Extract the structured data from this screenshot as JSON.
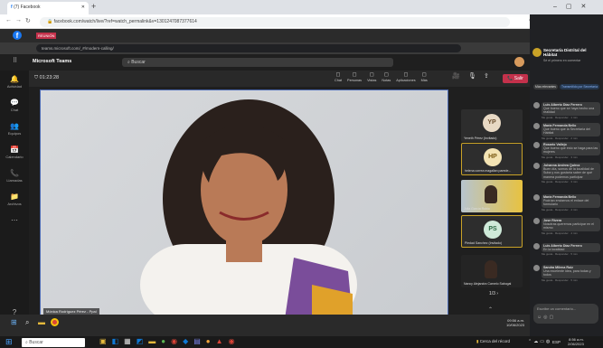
{
  "outer_browser": {
    "tab_title": "(7) Facebook",
    "url": "facebook.com/watch/live/?ref=watch_permalink&v=1301247087377614",
    "tab_close": "✕"
  },
  "inner_browser": {
    "tab_badge": "REUNIÓN",
    "url": "teams.microsoft.com/_#/modern-calling/"
  },
  "teams": {
    "app_name": "Microsoft Teams",
    "search_placeholder": "Buscar",
    "timer": "01:23:28",
    "controls": [
      "Chat",
      "Personas",
      "Vistas",
      "Notas",
      "Aplicaciones",
      "Más"
    ],
    "leave_label": "Salir",
    "rail": [
      {
        "icon": "🔔",
        "label": "Actividad"
      },
      {
        "icon": "💬",
        "label": "Chat"
      },
      {
        "icon": "👥",
        "label": "Equipos"
      },
      {
        "icon": "📅",
        "label": "Calendario"
      },
      {
        "icon": "📞",
        "label": "Llamadas"
      },
      {
        "icon": "📁",
        "label": "Archivos"
      },
      {
        "icon": "⋯",
        "label": ""
      },
      {
        "icon": "?",
        "label": "Ayuda"
      }
    ],
    "main_speaker": "Mónica Rodríguez Pérez - Ppal",
    "participants": [
      {
        "initials": "YP",
        "name": "Yeneth Pérez (Invitado)",
        "color": "#e8d9c4",
        "text": "#6b4f2e"
      },
      {
        "initials": "HP",
        "name": "helena correa magallan parede...",
        "color": "#f3e3b3",
        "text": "#7a5a12",
        "active": true
      },
      {
        "initials": "",
        "name": "Julia García Rubio",
        "color": "",
        "text": "",
        "video": true
      },
      {
        "initials": "PS",
        "name": "Piedad Sanchez (Invitado)",
        "color": "#cfead9",
        "text": "#2d6a45",
        "active": true
      },
      {
        "initials": "",
        "name": "Nancy Alejandra Camelo Sabogal",
        "color": "",
        "text": "",
        "video": true
      }
    ],
    "pagination": "1/3"
  },
  "chat_panel": {
    "header_name": "Secretaría Distrital del Hábitat",
    "header_sub": "Sé el primero en comentar",
    "tabs": [
      "Más relevantes",
      "Transmitido por Secretaría"
    ],
    "messages": [
      {
        "name": "Luis Alberto Díaz Ferrero",
        "text": "Que bueno que se haya hecho una realidad",
        "meta": "Me gusta · Responder · 1 min"
      },
      {
        "name": "María Fernanda Bello",
        "text": "Que bueno que la Secretaría del Hábitat",
        "meta": "Me gusta · Responder · 2 min"
      },
      {
        "name": "Rosario Vallejo",
        "text": "Que bueno que esto se haga para las mujeres",
        "meta": "Me gusta · Responder · 3 min"
      },
      {
        "name": "Johanna Andrea Quiroz",
        "text": "Buen día, somos de la localidad de Suba y nos gustaría saber de qué manera podemos participar",
        "meta": "Me gusta · Responder · 3 min"
      },
      {
        "name": "María Fernanda Bello",
        "text": "Podrían enviarnos el enlace del formulario",
        "meta": "Me gusta · Responder · 4 min"
      },
      {
        "name": "Jose Rivera",
        "text": "Nosotras queremos participar en el mismo",
        "meta": "Me gusta · Responder · 4 min"
      },
      {
        "name": "Luis Alberto Díaz Ferrero",
        "text": "En la localidad",
        "meta": "Me gusta · Responder · 5 min"
      },
      {
        "name": "Sandra Milena Ruiz",
        "text": "Una excelente idea, para todas y todos",
        "meta": "Me gusta · Responder · 5 min"
      }
    ],
    "comment_placeholder": "Escribe un comentario..."
  },
  "inner_taskbar": {
    "time": "09:56 a.m.",
    "date": "10/06/2023"
  },
  "win_taskbar": {
    "search_placeholder": "Buscar",
    "weather": "Cerca del récord",
    "lang": "ESP",
    "time": "8:56 a.m.",
    "date": "2/06/2023"
  }
}
